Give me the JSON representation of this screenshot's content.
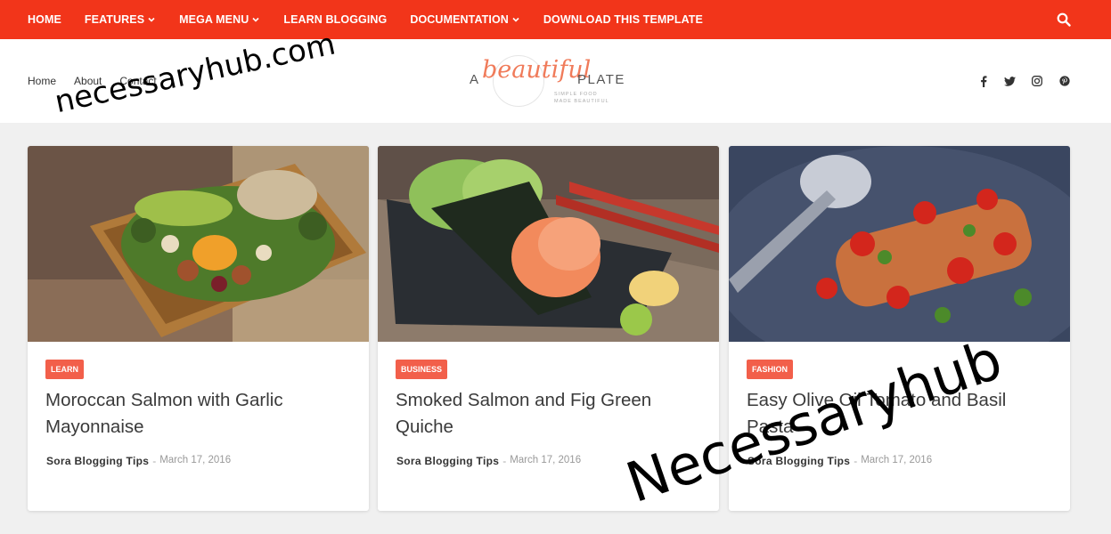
{
  "topnav": {
    "items": [
      {
        "label": "HOME",
        "dropdown": false
      },
      {
        "label": "FEATURES",
        "dropdown": true
      },
      {
        "label": "MEGA MENU",
        "dropdown": true
      },
      {
        "label": "LEARN BLOGGING",
        "dropdown": false
      },
      {
        "label": "DOCUMENTATION",
        "dropdown": true
      },
      {
        "label": "DOWNLOAD THIS TEMPLATE",
        "dropdown": false
      }
    ],
    "search_icon": "search-icon",
    "bg_color": "#f2351a"
  },
  "header": {
    "pages": [
      "Home",
      "About",
      "Contact"
    ],
    "logo": {
      "a": "A",
      "script": "beautiful",
      "plate": "PLATE",
      "tagline1": "SIMPLE FOOD",
      "tagline2": "MADE BEAUTIFUL"
    },
    "social_icons": [
      "facebook-icon",
      "twitter-icon",
      "instagram-icon",
      "pinterest-icon"
    ]
  },
  "posts": [
    {
      "category": "LEARN",
      "title": "Moroccan Salmon with Garlic Mayonnaise",
      "author": "Sora Blogging Tips",
      "separator": "-",
      "date": "March 17, 2016"
    },
    {
      "category": "BUSINESS",
      "title": "Smoked Salmon and Fig Green Quiche",
      "author": "Sora Blogging Tips",
      "separator": "-",
      "date": "March 17, 2016"
    },
    {
      "category": "FASHION",
      "title": "Easy Olive Oil Tomato and Basil Pasta",
      "author": "Sora Blogging Tips",
      "separator": "-",
      "date": "March 17, 2016"
    }
  ],
  "watermarks": [
    "necessaryhub.com",
    "Necessaryhub"
  ],
  "colors": {
    "accent": "#f2351a",
    "badge": "#f25f4a",
    "logo_script": "#f07b5a"
  }
}
